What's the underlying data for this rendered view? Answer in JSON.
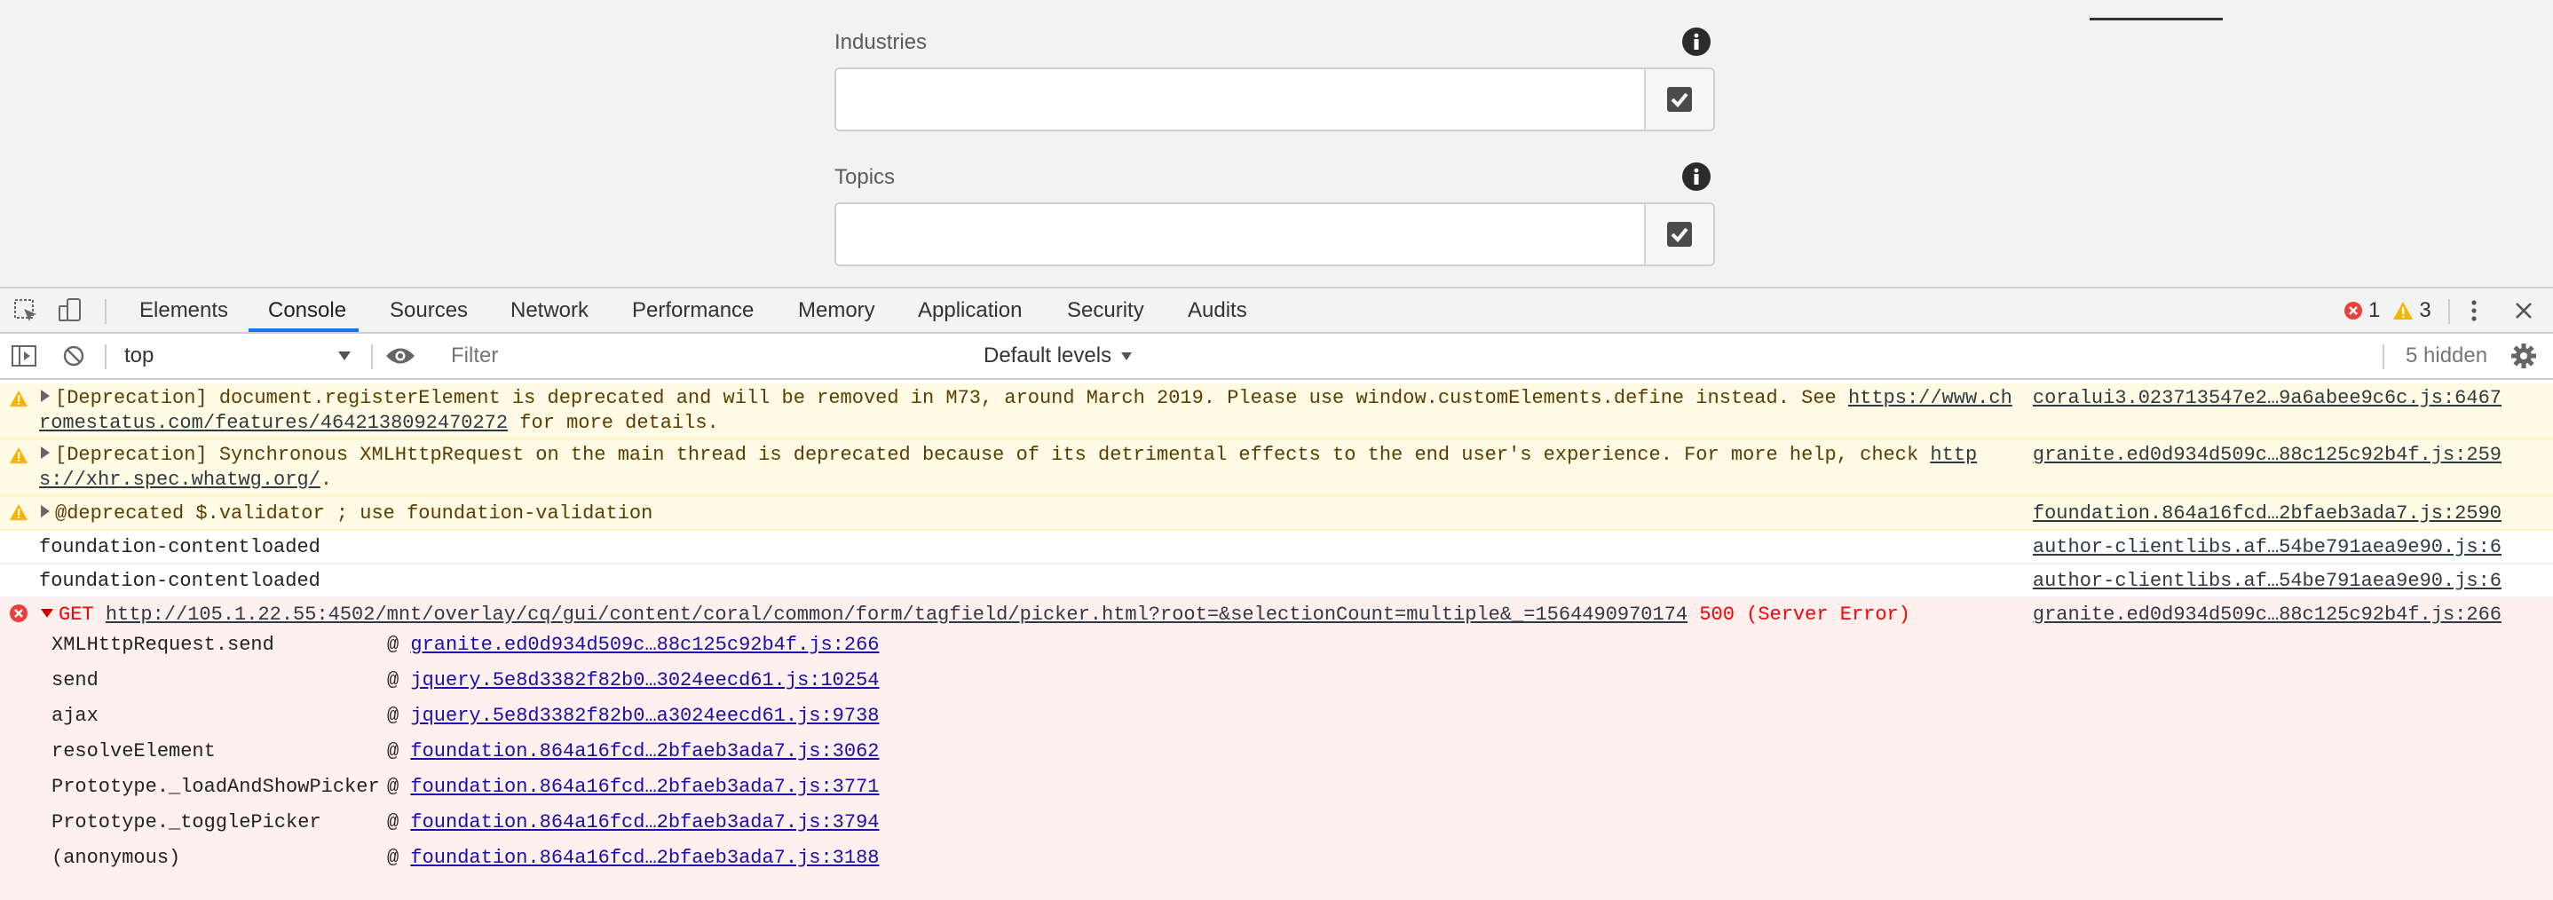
{
  "form": {
    "industries_label": "Industries",
    "topics_label": "Topics",
    "industries_value": "",
    "topics_value": ""
  },
  "devtools": {
    "tabs": [
      "Elements",
      "Console",
      "Sources",
      "Network",
      "Performance",
      "Memory",
      "Application",
      "Security",
      "Audits"
    ],
    "active_tab": "Console",
    "error_count": "1",
    "warning_count": "3",
    "context_select": "top",
    "filter_placeholder": "Filter",
    "levels_label": "Default levels",
    "hidden_count": "5 hidden"
  },
  "console": {
    "warning1": {
      "text_a": "[Deprecation] document.registerElement is deprecated and will be removed in M73, around March 2019. Please use window.customElements.define instead. See ",
      "link_a": "https://www.ch",
      "link_b": "romestatus.com/features/4642138092470272",
      "text_b": " for more details.",
      "source": "coralui3.023713547e2…9a6abee9c6c.js:6467"
    },
    "warning2": {
      "text_a": "[Deprecation] Synchronous XMLHttpRequest on the main thread is deprecated because of its detrimental effects to the end user's experience. For more help, check ",
      "link_a": "http",
      "link_b": "s://xhr.spec.whatwg.org/",
      "text_b": ".",
      "source": "granite.ed0d934d509c…88c125c92b4f.js:259"
    },
    "warning3": {
      "text": "@deprecated  $.validator ; use foundation-validation",
      "source": "foundation.864a16fcd…2bfaeb3ada7.js:2590"
    },
    "info1": {
      "text": "foundation-contentloaded",
      "source": "author-clientlibs.af…54be791aea9e90.js:6"
    },
    "info2": {
      "text": "foundation-contentloaded",
      "source": "author-clientlibs.af…54be791aea9e90.js:6"
    },
    "error": {
      "method": "GET",
      "url": "http://105.1.22.55:4502/mnt/overlay/cq/gui/content/coral/common/form/tagfield/picker.html?root=&selectionCount=multiple&_=1564490970174",
      "status": "500 (Server Error)",
      "source": "granite.ed0d934d509c…88c125c92b4f.js:266",
      "stack": [
        {
          "fn": "XMLHttpRequest.send",
          "loc": "granite.ed0d934d509c…88c125c92b4f.js:266"
        },
        {
          "fn": "send",
          "loc": "jquery.5e8d3382f82b0…3024eecd61.js:10254"
        },
        {
          "fn": "ajax",
          "loc": "jquery.5e8d3382f82b0…a3024eecd61.js:9738"
        },
        {
          "fn": "resolveElement",
          "loc": "foundation.864a16fcd…2bfaeb3ada7.js:3062"
        },
        {
          "fn": "Prototype._loadAndShowPicker",
          "loc": "foundation.864a16fcd…2bfaeb3ada7.js:3771"
        },
        {
          "fn": "Prototype._togglePicker",
          "loc": "foundation.864a16fcd…2bfaeb3ada7.js:3794"
        },
        {
          "fn": "(anonymous)",
          "loc": "foundation.864a16fcd…2bfaeb3ada7.js:3188"
        }
      ]
    }
  }
}
